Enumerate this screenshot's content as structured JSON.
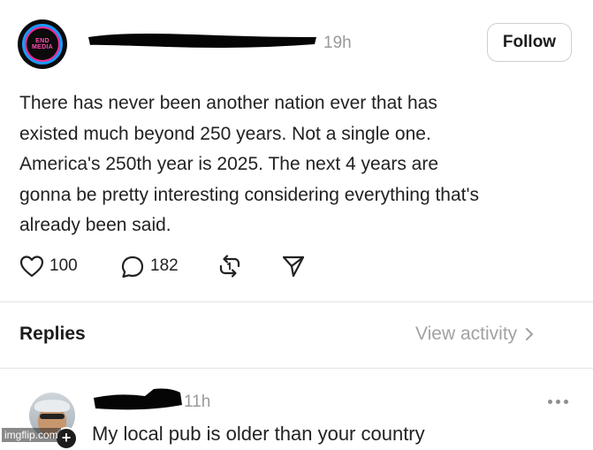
{
  "post": {
    "avatar_logo_text": "END MEDIA",
    "time": "19h",
    "follow_label": "Follow",
    "body_lines": [
      "There has never been another nation ever that has",
      "existed much beyond 250 years. Not a single one.",
      "America's 250th year is 2025. The next 4 years are",
      "gonna be pretty interesting considering everything that's",
      "already been said."
    ],
    "likes": "100",
    "replies_count": "182",
    "icons": [
      "heart-icon",
      "comment-icon",
      "repost-icon",
      "share-icon"
    ]
  },
  "replies_section": {
    "heading": "Replies",
    "view_activity": "View activity"
  },
  "reply": {
    "time": "11h",
    "text": "My local pub is older than your country"
  },
  "watermark": "imgflip.com"
}
